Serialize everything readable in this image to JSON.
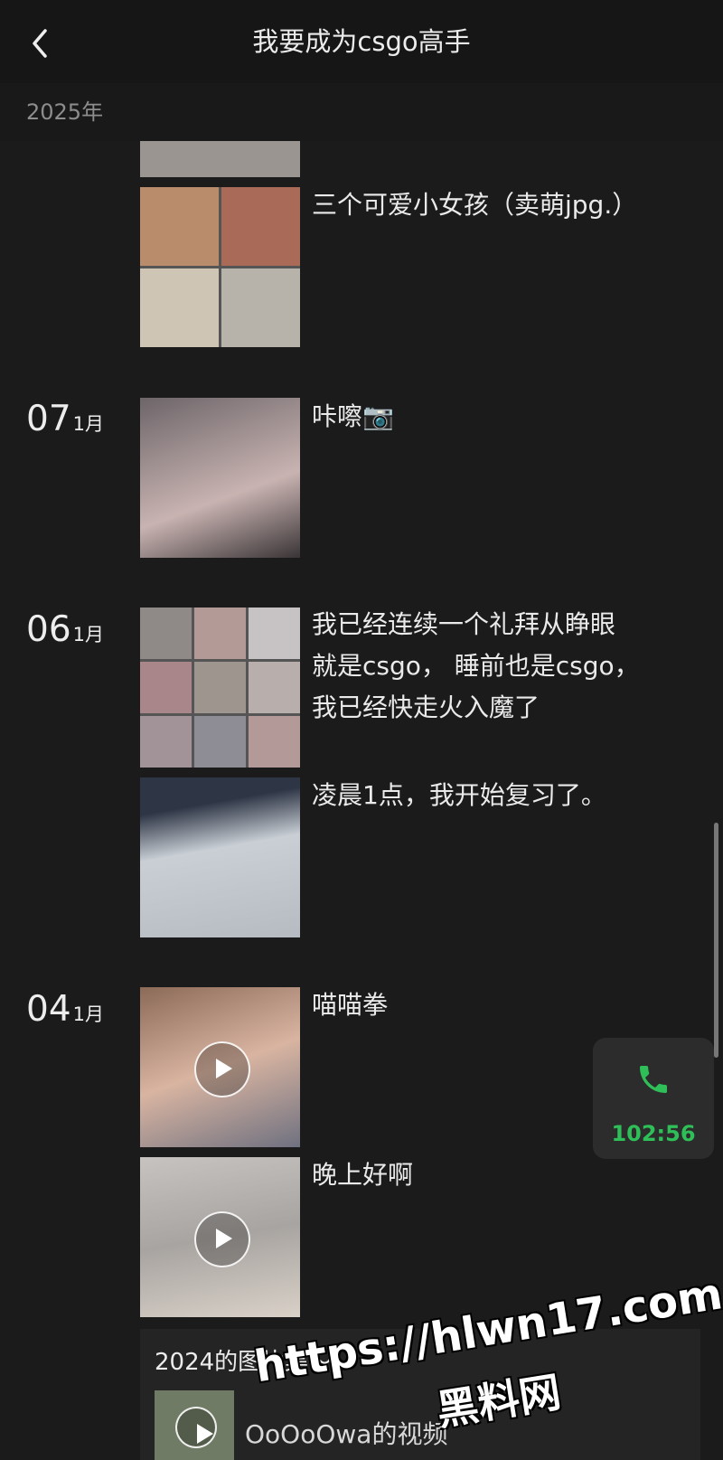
{
  "header": {
    "title": "我要成为csgo高手"
  },
  "year_label": "2025年",
  "entries": [
    {
      "caption": "三个可爱小女孩（卖萌jpg.）"
    },
    {
      "day": "07",
      "month": "1月",
      "caption": "咔嚓📷"
    },
    {
      "day": "06",
      "month": "1月",
      "caption_lines": [
        "我已经连续一个礼拜从睁眼",
        "就是csgo， 睡前也是csgo，",
        "我已经快走火入魔了"
      ]
    },
    {
      "caption": "凌晨1点，我开始复习了。"
    },
    {
      "day": "04",
      "month": "1月",
      "caption": "喵喵拳"
    },
    {
      "caption": "晚上好啊"
    }
  ],
  "album": {
    "title": "2024的图片集～",
    "subtitle": "OoOoOwa的视频"
  },
  "call": {
    "timer": "102:56",
    "color": "#2fbf58"
  },
  "watermark": {
    "line1": "https://hlwn17.com",
    "line2": "黑料网"
  }
}
